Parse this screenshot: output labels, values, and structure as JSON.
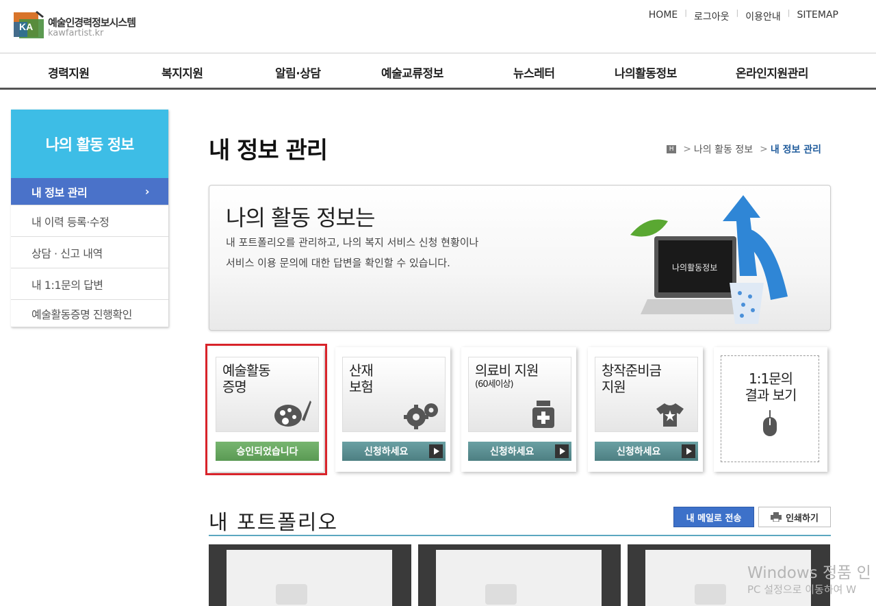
{
  "logo": {
    "title": "예술인경력정보시스템",
    "url": "kawfartist.kr",
    "mark": "KA"
  },
  "util_links": [
    "HOME",
    "로그아웃",
    "이용안내",
    "SITEMAP"
  ],
  "gnb": [
    "경력지원",
    "복지지원",
    "알림·상담",
    "예술교류정보",
    "뉴스레터",
    "나의활동정보",
    "온라인지원관리"
  ],
  "lnb": {
    "title": "나의 활동 정보",
    "items": [
      "내 정보 관리",
      "내 이력 등록·수정",
      "상담 · 신고 내역",
      "내 1:1문의 답변",
      "예술활동증명 진행확인"
    ]
  },
  "page_title": "내 정보 관리",
  "breadcrumb": {
    "home": "H",
    "section": "나의 활동 정보",
    "current": "내 정보 관리"
  },
  "intro": {
    "heading": "나의 활동 정보는",
    "line1": "내 포트폴리오를 관리하고, 나의 복지 서비스 신청 현황이나",
    "line2": "서비스 이용 문의에 대한 답변을 확인할 수 있습니다.",
    "laptop_text": "나의활동정보"
  },
  "cards": [
    {
      "line1": "예술활동",
      "line2": "증명",
      "button": "승인되었습니다",
      "icon": "palette-icon"
    },
    {
      "line1": "산재",
      "line2": "보험",
      "button": "신청하세요",
      "icon": "gears-icon"
    },
    {
      "line1": "의료비 지원",
      "sub": "(60세이상)",
      "button": "신청하세요",
      "icon": "medicine-bottle-icon"
    },
    {
      "line1": "창작준비금",
      "line2": "지원",
      "button": "신청하세요",
      "icon": "shirt-star-icon"
    },
    {
      "line1": "1:1문의",
      "line2": "결과 보기",
      "icon": "mouse-icon"
    }
  ],
  "portfolio": {
    "title": "내 포트폴리오",
    "send_button": "내 메일로 전송",
    "print_button": "인쇄하기"
  },
  "watermark": {
    "line1": "Windows 정품 인",
    "line2": "PC 설정으로 이동하여 W"
  },
  "colors": {
    "accent_blue": "#3dbde6",
    "active_nav": "#4a72c9",
    "button_teal": "#5a8f92",
    "button_green": "#62a55b",
    "highlight_red": "#d8232a"
  }
}
